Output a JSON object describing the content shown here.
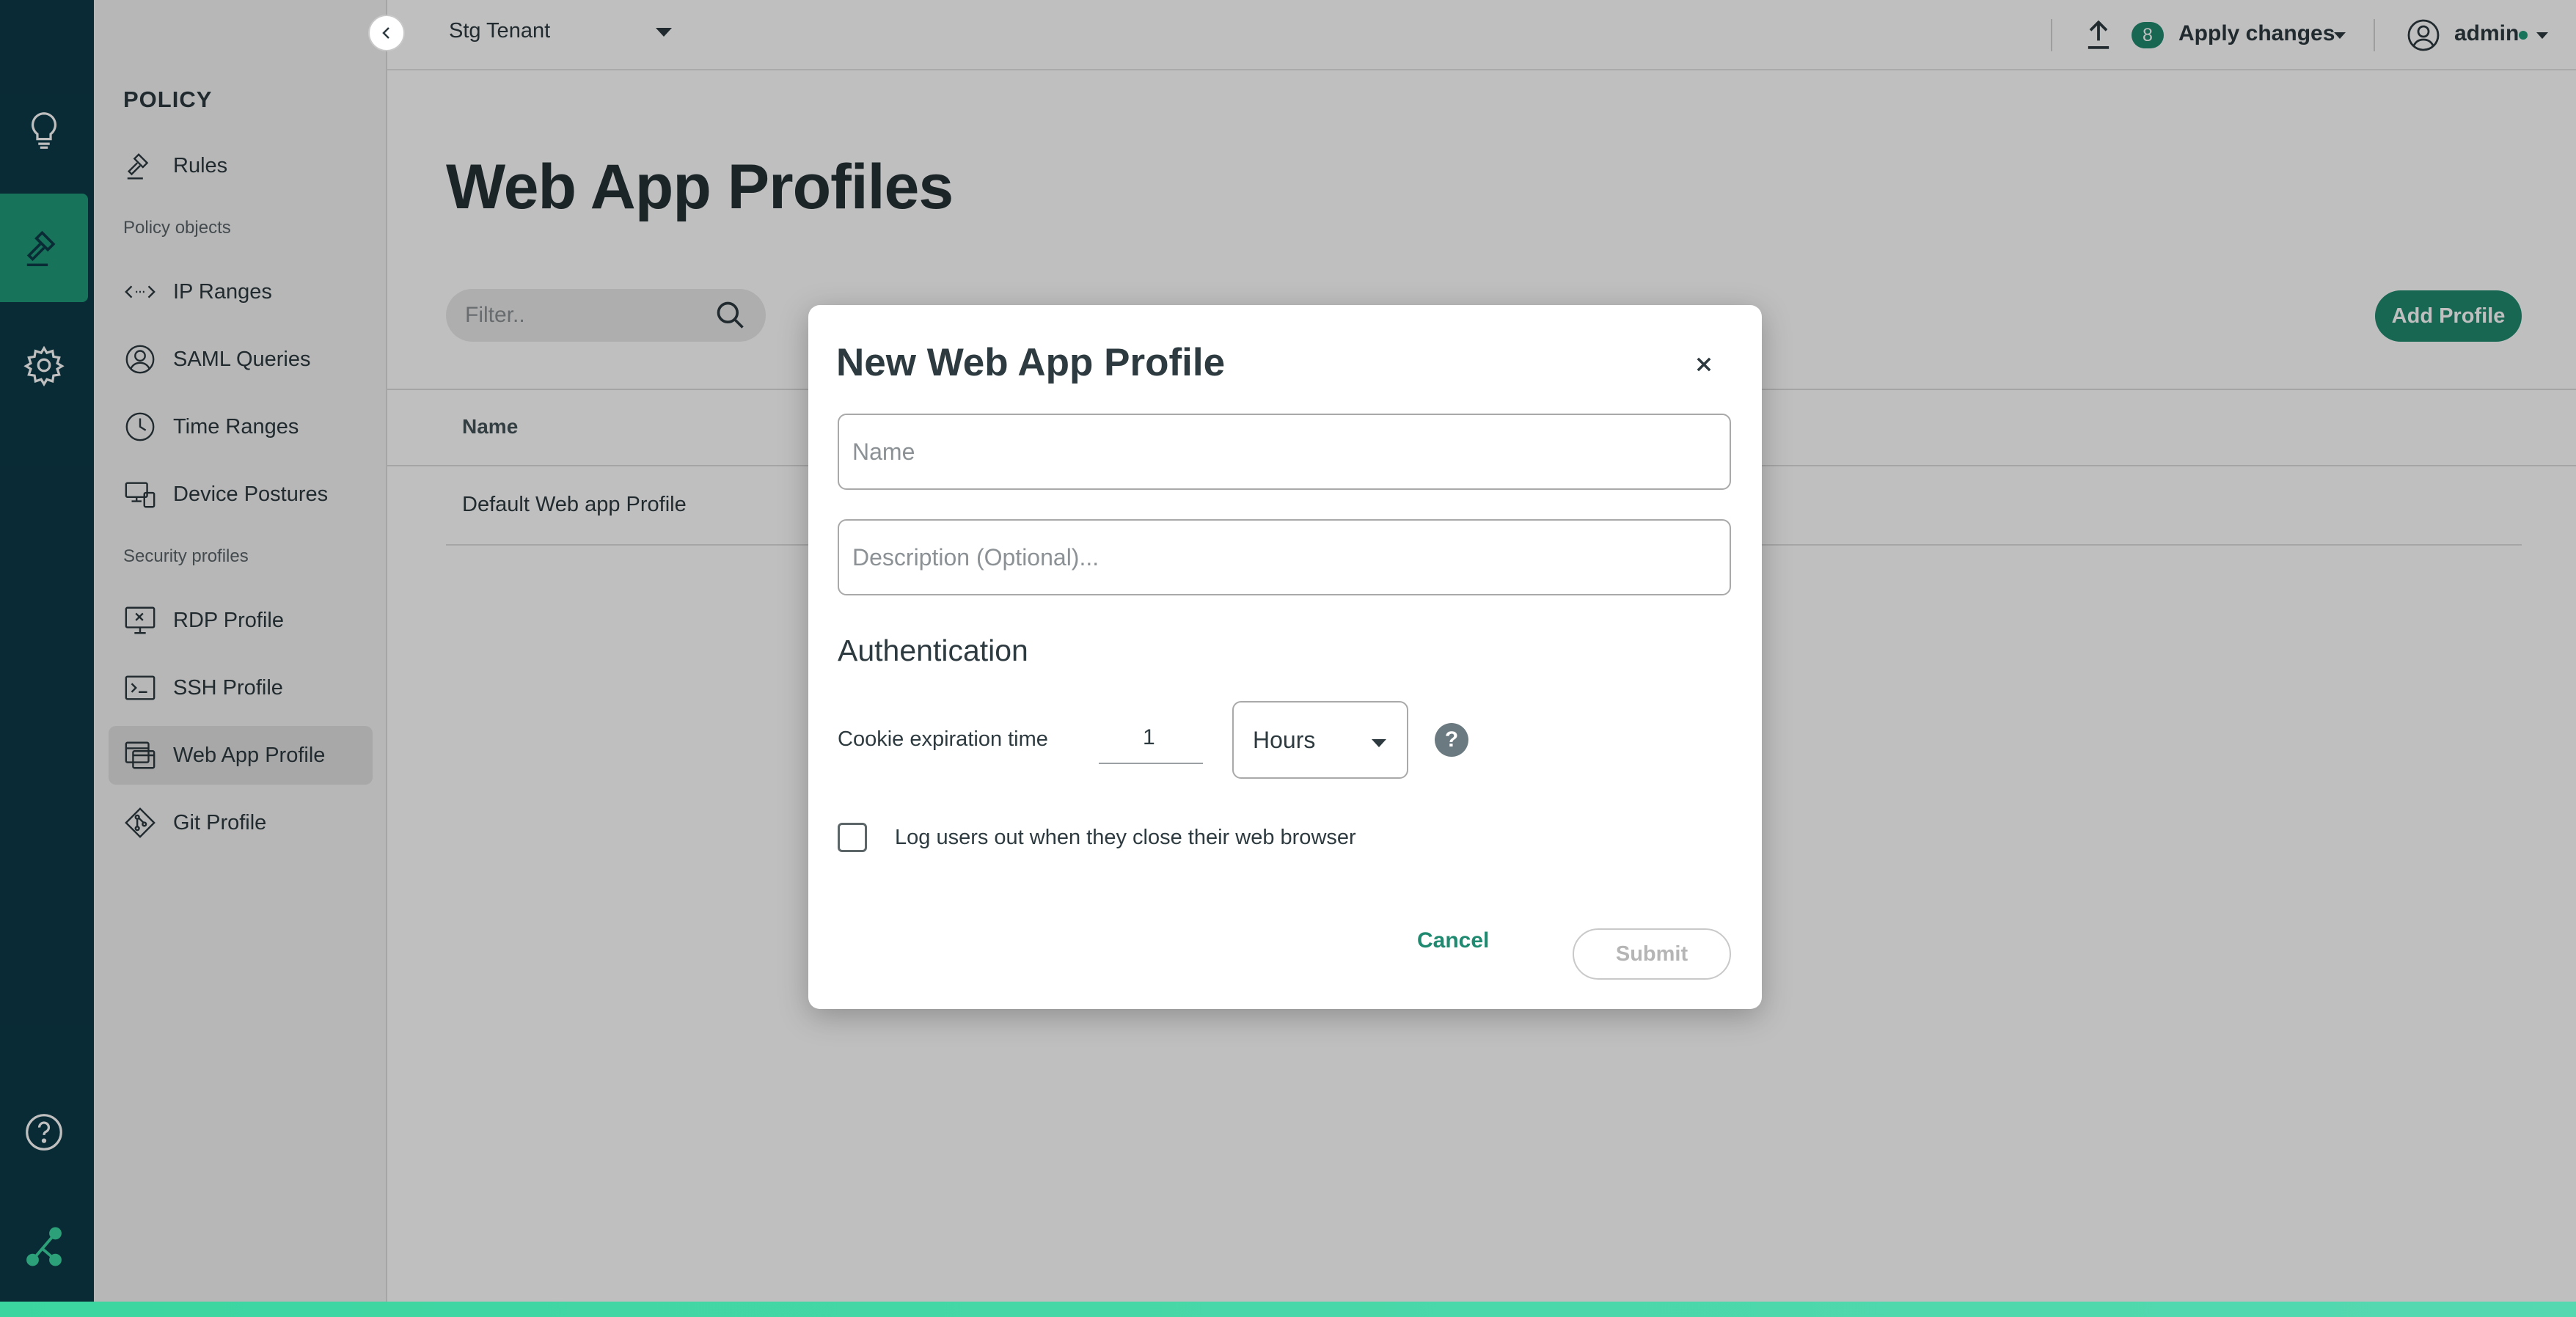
{
  "topbar": {
    "tenant": "Stg Tenant",
    "apply_count": "8",
    "apply_label": "Apply changes",
    "user": "admin"
  },
  "sidebar": {
    "heading": "POLICY",
    "rules": "Rules",
    "section_policy_objects": "Policy objects",
    "ip_ranges": "IP Ranges",
    "saml_queries": "SAML Queries",
    "time_ranges": "Time Ranges",
    "device_postures": "Device Postures",
    "section_security_profiles": "Security profiles",
    "rdp_profile": "RDP Profile",
    "ssh_profile": "SSH Profile",
    "web_app_profile": "Web App Profile",
    "git_profile": "Git Profile"
  },
  "main": {
    "title": "Web App Profiles",
    "filter_placeholder": "Filter..",
    "add_profile": "Add Profile",
    "columns": [
      "Name"
    ],
    "rows": [
      {
        "name": "Default Web app Profile"
      }
    ]
  },
  "modal": {
    "title": "New Web App Profile",
    "name_placeholder": "Name",
    "description_placeholder": "Description (Optional)...",
    "auth_heading": "Authentication",
    "cookie_label": "Cookie expiration time",
    "cookie_value": "1",
    "cookie_unit": "Hours",
    "help": "?",
    "logout_label": "Log users out when they close their web browser",
    "logout_checked": false,
    "cancel": "Cancel",
    "submit": "Submit"
  },
  "colors": {
    "rail_bg": "#0d3a47",
    "accent": "#1f8a6f",
    "active_rail": "#1f9b7a"
  }
}
